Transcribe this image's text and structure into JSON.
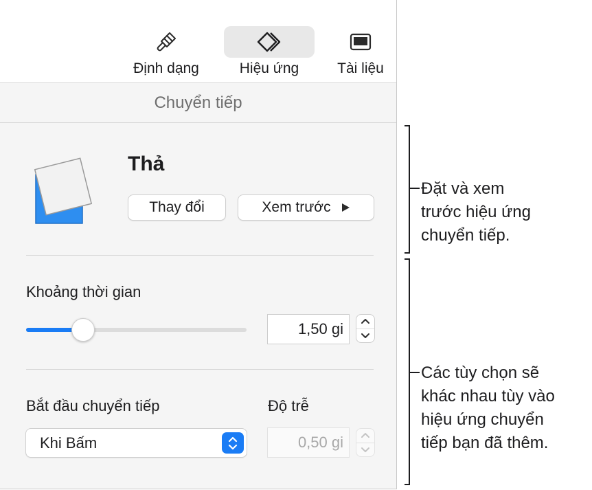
{
  "toolbar": {
    "format_label": "Định dạng",
    "animate_label": "Hiệu ứng",
    "document_label": "Tài liệu",
    "icons": [
      "paintbrush-icon",
      "diamond-animate-icon",
      "document-panel-icon"
    ],
    "active_tab": "animate"
  },
  "section": {
    "title": "Chuyển tiếp"
  },
  "transition": {
    "name": "Thả",
    "change_label": "Thay đổi",
    "preview_label": "Xem trước",
    "preview_icon": "play-icon"
  },
  "duration": {
    "label": "Khoảng thời gian",
    "value": "1,50 gi",
    "slider_fraction": 0.25
  },
  "start": {
    "label": "Bắt đầu chuyển tiếp",
    "selected": "Khi Bấm"
  },
  "delay": {
    "label": "Độ trễ",
    "value": "0,50 gi",
    "disabled": true
  },
  "callouts": [
    {
      "lines": [
        "Đặt và xem",
        "trước hiệu ứng",
        "chuyển tiếp."
      ]
    },
    {
      "lines": [
        "Các tùy chọn sẽ",
        "khác nhau tùy vào",
        "hiệu ứng chuyển",
        "tiếp bạn đã thêm."
      ]
    }
  ],
  "colors": {
    "accent": "#1a7cf5",
    "panel_bg": "#f5f5f5",
    "thumb_blue": "#2e8ef0"
  }
}
